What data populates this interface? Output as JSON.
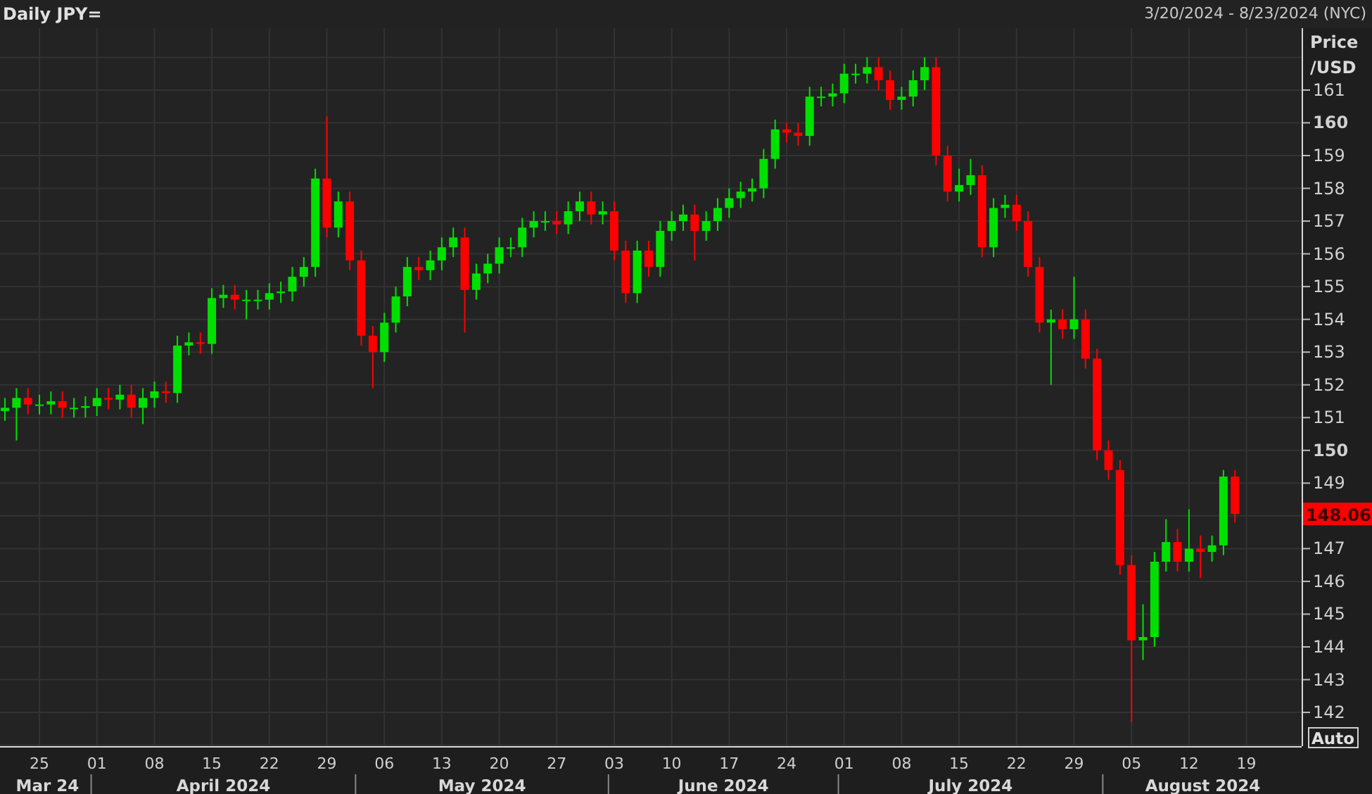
{
  "header": {
    "title": "Daily JPY=",
    "date_range": "3/20/2024 - 8/23/2024 (NYC)"
  },
  "chart": {
    "last_price": "148.06",
    "autoscale_button": "Auto",
    "month_labels": [
      "Mar 24",
      "April 2024",
      "May 2024",
      "June 2024",
      "July 2024",
      "August 2024"
    ],
    "chart_data": {
      "type": "candlestick",
      "ylabel": "Price /USD",
      "grid": true,
      "ylim": [
        140.97,
        162.89
      ],
      "yticks": [
        142,
        143,
        144,
        145,
        146,
        147,
        149,
        150,
        151,
        152,
        153,
        154,
        155,
        156,
        157,
        158,
        159,
        160,
        161
      ],
      "categories": [
        null,
        null,
        null,
        "25",
        null,
        null,
        null,
        null,
        "01",
        null,
        null,
        null,
        null,
        "08",
        null,
        null,
        null,
        null,
        "15",
        null,
        null,
        null,
        null,
        "22",
        null,
        null,
        null,
        null,
        "29",
        null,
        null,
        null,
        null,
        "06",
        null,
        null,
        null,
        null,
        "13",
        null,
        null,
        null,
        null,
        "20",
        null,
        null,
        null,
        null,
        "27",
        null,
        null,
        null,
        null,
        "03",
        null,
        null,
        null,
        null,
        "10",
        null,
        null,
        null,
        null,
        "17",
        null,
        null,
        null,
        null,
        "24",
        null,
        null,
        null,
        null,
        "01",
        null,
        null,
        null,
        null,
        "08",
        null,
        null,
        null,
        null,
        "15",
        null,
        null,
        null,
        null,
        "22",
        null,
        null,
        null,
        null,
        "29",
        null,
        null,
        null,
        null,
        "05",
        null,
        null,
        null,
        null,
        "12",
        null,
        null,
        null,
        null,
        "19"
      ],
      "ohlc": [
        [
          151.2,
          151.6,
          150.9,
          151.3
        ],
        [
          151.3,
          151.9,
          150.3,
          151.6
        ],
        [
          151.6,
          151.9,
          151.1,
          151.4
        ],
        [
          151.4,
          151.7,
          151.1,
          151.4
        ],
        [
          151.4,
          151.8,
          151.1,
          151.5
        ],
        [
          151.5,
          151.8,
          151.0,
          151.3
        ],
        [
          151.3,
          151.6,
          151.0,
          151.3
        ],
        [
          151.3,
          151.65,
          151.0,
          151.35
        ],
        [
          151.35,
          151.9,
          151.05,
          151.6
        ],
        [
          151.6,
          151.9,
          151.25,
          151.55
        ],
        [
          151.55,
          152.0,
          151.25,
          151.7
        ],
        [
          151.7,
          152.0,
          151.0,
          151.3
        ],
        [
          151.3,
          151.9,
          150.8,
          151.6
        ],
        [
          151.6,
          152.1,
          151.3,
          151.8
        ],
        [
          151.8,
          152.1,
          151.45,
          151.75
        ],
        [
          151.75,
          153.5,
          151.45,
          153.2
        ],
        [
          153.2,
          153.6,
          152.9,
          153.3
        ],
        [
          153.3,
          153.6,
          152.95,
          153.25
        ],
        [
          153.25,
          154.95,
          152.95,
          154.65
        ],
        [
          154.65,
          155.05,
          154.35,
          154.75
        ],
        [
          154.75,
          155.05,
          154.3,
          154.6
        ],
        [
          154.6,
          154.9,
          154.0,
          154.6
        ],
        [
          154.6,
          154.9,
          154.3,
          154.6
        ],
        [
          154.6,
          155.1,
          154.3,
          154.8
        ],
        [
          154.8,
          155.15,
          154.5,
          154.85
        ],
        [
          154.85,
          155.6,
          154.55,
          155.3
        ],
        [
          155.3,
          155.9,
          155.0,
          155.6
        ],
        [
          155.6,
          158.6,
          155.3,
          158.3
        ],
        [
          158.3,
          160.2,
          156.5,
          156.8
        ],
        [
          156.8,
          157.9,
          156.5,
          157.6
        ],
        [
          157.6,
          157.9,
          155.5,
          155.8
        ],
        [
          155.8,
          156.1,
          153.2,
          153.5
        ],
        [
          153.5,
          153.8,
          151.9,
          153.0
        ],
        [
          153.0,
          154.2,
          152.7,
          153.9
        ],
        [
          153.9,
          155.0,
          153.6,
          154.7
        ],
        [
          154.7,
          155.9,
          154.4,
          155.6
        ],
        [
          155.6,
          155.9,
          155.2,
          155.5
        ],
        [
          155.5,
          156.1,
          155.2,
          155.8
        ],
        [
          155.8,
          156.5,
          155.5,
          156.2
        ],
        [
          156.2,
          156.8,
          155.9,
          156.5
        ],
        [
          156.5,
          156.8,
          153.6,
          154.9
        ],
        [
          154.9,
          155.7,
          154.6,
          155.4
        ],
        [
          155.4,
          156.0,
          155.1,
          155.7
        ],
        [
          155.7,
          156.5,
          155.4,
          156.2
        ],
        [
          156.2,
          156.5,
          155.9,
          156.2
        ],
        [
          156.2,
          157.1,
          155.9,
          156.8
        ],
        [
          156.8,
          157.3,
          156.5,
          157.0
        ],
        [
          157.0,
          157.3,
          156.7,
          157.0
        ],
        [
          157.0,
          157.3,
          156.6,
          156.9
        ],
        [
          156.9,
          157.6,
          156.6,
          157.3
        ],
        [
          157.3,
          157.9,
          157.0,
          157.6
        ],
        [
          157.6,
          157.9,
          156.9,
          157.2
        ],
        [
          157.2,
          157.6,
          156.9,
          157.3
        ],
        [
          157.3,
          157.6,
          155.8,
          156.1
        ],
        [
          156.1,
          156.4,
          154.5,
          154.8
        ],
        [
          154.8,
          156.4,
          154.5,
          156.1
        ],
        [
          156.1,
          156.4,
          155.3,
          155.6
        ],
        [
          155.6,
          157.0,
          155.3,
          156.7
        ],
        [
          156.7,
          157.3,
          156.4,
          157.0
        ],
        [
          157.0,
          157.5,
          156.7,
          157.2
        ],
        [
          157.2,
          157.5,
          155.8,
          156.7
        ],
        [
          156.7,
          157.3,
          156.4,
          157.0
        ],
        [
          157.0,
          157.7,
          156.7,
          157.4
        ],
        [
          157.4,
          158.0,
          157.1,
          157.7
        ],
        [
          157.7,
          158.2,
          157.4,
          157.9
        ],
        [
          157.9,
          158.3,
          157.6,
          158.0
        ],
        [
          158.0,
          159.2,
          157.7,
          158.9
        ],
        [
          158.9,
          160.1,
          158.6,
          159.8
        ],
        [
          159.8,
          160.0,
          159.4,
          159.7
        ],
        [
          159.7,
          160.0,
          159.3,
          159.6
        ],
        [
          159.6,
          161.1,
          159.3,
          160.8
        ],
        [
          160.8,
          161.1,
          160.5,
          160.8
        ],
        [
          160.8,
          161.2,
          160.5,
          160.9
        ],
        [
          160.9,
          161.8,
          160.6,
          161.5
        ],
        [
          161.5,
          161.8,
          161.2,
          161.5
        ],
        [
          161.5,
          162.0,
          161.2,
          161.7
        ],
        [
          161.7,
          162.0,
          161.0,
          161.3
        ],
        [
          161.3,
          161.6,
          160.4,
          160.7
        ],
        [
          160.7,
          161.1,
          160.4,
          160.8
        ],
        [
          160.8,
          161.6,
          160.5,
          161.3
        ],
        [
          161.3,
          162.0,
          161.0,
          161.7
        ],
        [
          161.7,
          162.0,
          158.7,
          159.0
        ],
        [
          159.0,
          159.3,
          157.6,
          157.9
        ],
        [
          157.9,
          158.6,
          157.6,
          158.1
        ],
        [
          158.1,
          158.9,
          157.8,
          158.4
        ],
        [
          158.4,
          158.7,
          155.9,
          156.2
        ],
        [
          156.2,
          157.7,
          155.9,
          157.4
        ],
        [
          157.4,
          157.8,
          157.1,
          157.5
        ],
        [
          157.5,
          157.8,
          156.7,
          157.0
        ],
        [
          157.0,
          157.3,
          155.3,
          155.6
        ],
        [
          155.6,
          155.9,
          153.6,
          153.9
        ],
        [
          153.9,
          154.3,
          152.0,
          154.0
        ],
        [
          154.0,
          154.3,
          153.4,
          153.7
        ],
        [
          153.7,
          155.3,
          153.4,
          154.0
        ],
        [
          154.0,
          154.3,
          152.5,
          152.8
        ],
        [
          152.8,
          153.1,
          149.7,
          150.0
        ],
        [
          150.0,
          150.3,
          149.1,
          149.4
        ],
        [
          149.4,
          149.7,
          146.2,
          146.5
        ],
        [
          146.5,
          146.8,
          141.7,
          144.2
        ],
        [
          144.2,
          145.3,
          143.6,
          144.3
        ],
        [
          144.3,
          146.9,
          144.0,
          146.6
        ],
        [
          146.6,
          147.9,
          146.3,
          147.2
        ],
        [
          147.2,
          147.6,
          146.3,
          146.6
        ],
        [
          146.6,
          148.2,
          146.3,
          147.0
        ],
        [
          147.0,
          147.4,
          146.1,
          146.9
        ],
        [
          146.9,
          147.4,
          146.6,
          147.1
        ],
        [
          147.1,
          149.4,
          146.8,
          149.2
        ],
        [
          149.2,
          149.4,
          147.8,
          148.06
        ],
        null
      ]
    }
  }
}
